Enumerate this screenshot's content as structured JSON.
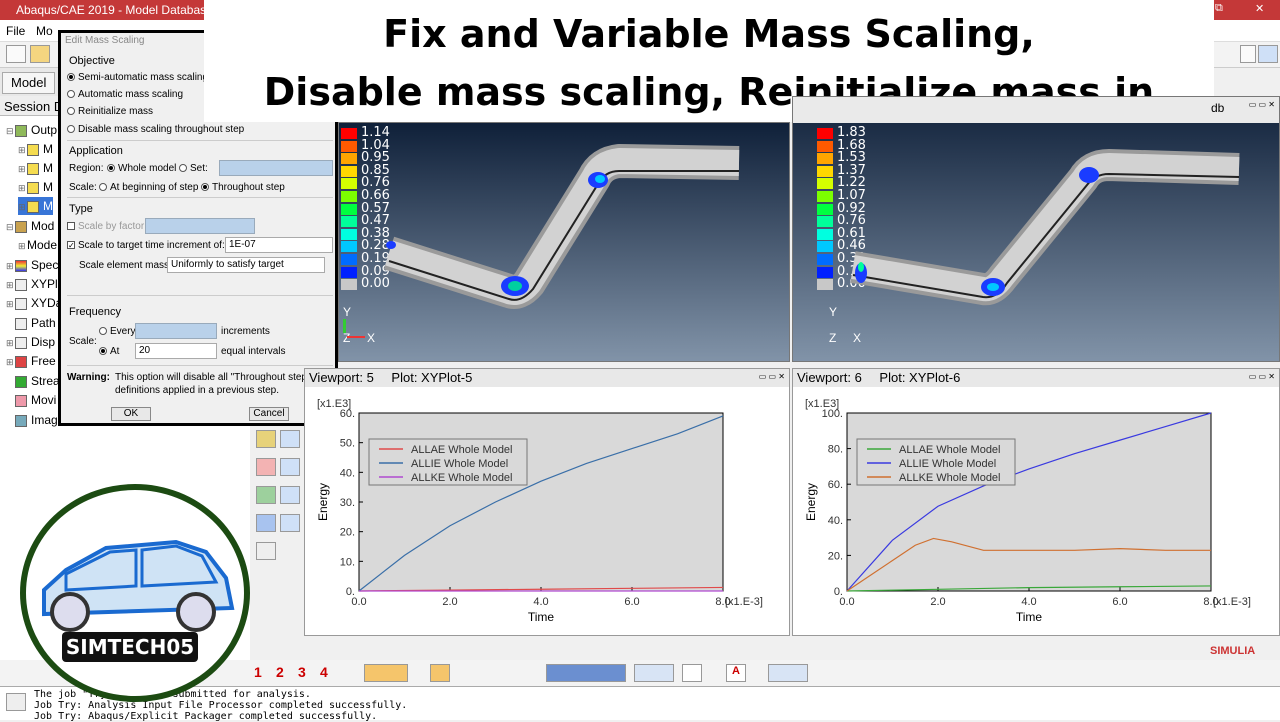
{
  "window": {
    "title": "Abaqus/CAE 2019 - Model Databas",
    "btn_restore": "⧉",
    "btn_close": "✕"
  },
  "menu": {
    "file": "File",
    "model": "Mo"
  },
  "tabs": {
    "model": "Model",
    "session": "Session D"
  },
  "tree": [
    {
      "label": "Outp",
      "icon": "output-db-icon"
    },
    {
      "label": "M",
      "icon": "lock-icon"
    },
    {
      "label": "M",
      "icon": "lock-icon"
    },
    {
      "label": "M",
      "icon": "lock-icon"
    },
    {
      "label": "M",
      "icon": "lock-icon"
    },
    {
      "label": "Mod",
      "icon": "model-icon"
    },
    {
      "label": "Mode",
      "icon": "model-icon"
    },
    {
      "label": "Spec",
      "icon": "spectrum-icon"
    },
    {
      "label": "XYPl",
      "icon": "xyplot-icon"
    },
    {
      "label": "XYDa",
      "icon": "xydata-icon"
    },
    {
      "label": "Path",
      "icon": "path-icon"
    },
    {
      "label": "Disp",
      "icon": "display-icon"
    },
    {
      "label": "Free",
      "icon": "freebody-icon"
    },
    {
      "label": "Strea",
      "icon": "stream-icon"
    },
    {
      "label": "Movi",
      "icon": "movie-icon"
    },
    {
      "label": "Imag",
      "icon": "image-icon"
    }
  ],
  "dialog": {
    "title": "Edit Mass Scaling",
    "objective": "Objective",
    "opt_semi": "Semi-automatic mass scaling",
    "opt_auto": "Automatic mass scaling",
    "opt_reinit": "Reinitialize mass",
    "opt_disable": "Disable mass scaling throughout step",
    "application": "Application",
    "region": "Region:",
    "whole_model": "Whole model",
    "set": "Set:",
    "scale": "Scale:",
    "at_beginning": "At beginning of step",
    "throughout": "Throughout step",
    "type": "Type",
    "scale_by_factor": "Scale by factor:",
    "scale_to_target": "Scale to target time increment of:",
    "target_value": "1E-07",
    "scale_elem_mass": "Scale element mass:",
    "elem_mass_value": "Uniformly to satisfy target",
    "frequency": "Frequency",
    "every": "Every",
    "increments": "increments",
    "at": "At",
    "at_value": "20",
    "equal_intervals": "equal intervals",
    "warning_label": "Warning:",
    "warning_text1": "This option will disable all \"Throughout step\"",
    "warning_text2": "definitions applied in a previous step.",
    "ok": "OK",
    "cancel": "Cancel"
  },
  "banner": {
    "line1": "Fix and Variable Mass Scaling,",
    "line2": "Disable mass scaling, Reinitialize mass in steps"
  },
  "contour_left": {
    "values": [
      "1.14",
      "1.04",
      "0.95",
      "0.85",
      "0.76",
      "0.66",
      "0.57",
      "0.47",
      "0.38",
      "0.28",
      "0.19",
      "0.09",
      "0.00"
    ]
  },
  "contour_right": {
    "values": [
      "1.83",
      "1.68",
      "1.53",
      "1.37",
      "1.22",
      "1.07",
      "0.92",
      "0.76",
      "0.61",
      "0.46",
      "0.31",
      "0.15",
      "0.00"
    ],
    "odb_label": "db"
  },
  "contour_colors": [
    "#ff0000",
    "#ff5a00",
    "#ffa500",
    "#ffd700",
    "#d4ff00",
    "#7cff00",
    "#00ff40",
    "#00ff9a",
    "#00ffe0",
    "#00c8ff",
    "#006cff",
    "#0020ff",
    "#c8c8c8"
  ],
  "triad": {
    "y": "Y",
    "z": "Z",
    "x": "X"
  },
  "viewport5": {
    "label": "Viewport: 5",
    "plot": "Plot: XYPlot-5"
  },
  "viewport6": {
    "label": "Viewport: 6",
    "plot": "Plot: XYPlot-6"
  },
  "chart_data": [
    {
      "type": "line",
      "ylabel": "Energy",
      "xlabel": "Time",
      "xunit": "[x1.E-3]",
      "yunit": "[x1.E3]",
      "xlim": [
        0,
        8
      ],
      "ylim": [
        0,
        60
      ],
      "xticks": [
        "0.0",
        "2.0",
        "4.0",
        "6.0",
        "8.0"
      ],
      "yticks": [
        "0.",
        "10.",
        "20.",
        "30.",
        "40.",
        "50.",
        "60."
      ],
      "series": [
        {
          "name": "ALLAE Whole Model",
          "color": "#e04a4a",
          "x": [
            0,
            2,
            4,
            6,
            8
          ],
          "y": [
            0,
            0.3,
            0.6,
            0.9,
            1.2
          ]
        },
        {
          "name": "ALLIE Whole Model",
          "color": "#3a6fa8",
          "x": [
            0,
            1,
            2,
            3,
            4,
            5,
            6,
            7,
            8
          ],
          "y": [
            0,
            12,
            22,
            30,
            37,
            43,
            48,
            53,
            59
          ]
        },
        {
          "name": "ALLKE Whole Model",
          "color": "#b04ad0",
          "x": [
            0,
            8
          ],
          "y": [
            0,
            0
          ]
        }
      ]
    },
    {
      "type": "line",
      "ylabel": "Energy",
      "xlabel": "Time",
      "xunit": "[x1.E-3]",
      "yunit": "[x1.E3]",
      "xlim": [
        0,
        8
      ],
      "ylim": [
        0,
        105
      ],
      "xticks": [
        "0.0",
        "2.0",
        "4.0",
        "6.0",
        "8.0"
      ],
      "yticks": [
        "0.",
        "20.",
        "40.",
        "60.",
        "80.",
        "100."
      ],
      "series": [
        {
          "name": "ALLAE Whole Model",
          "color": "#3aa83a",
          "x": [
            0,
            2,
            4,
            6,
            8
          ],
          "y": [
            0,
            1,
            2,
            2.5,
            3
          ]
        },
        {
          "name": "ALLIE Whole Model",
          "color": "#3a3ae0",
          "x": [
            0,
            1,
            2,
            3,
            4,
            5,
            6,
            7,
            8
          ],
          "y": [
            0,
            30,
            50,
            62,
            72,
            81,
            89,
            97,
            105
          ]
        },
        {
          "name": "ALLKE Whole Model",
          "color": "#d07030",
          "x": [
            0,
            0.5,
            1,
            1.5,
            1.9,
            2.3,
            3,
            4,
            5,
            6,
            7,
            8
          ],
          "y": [
            0,
            9,
            18,
            27,
            31,
            29,
            24,
            24,
            24,
            25,
            24,
            24
          ]
        }
      ]
    }
  ],
  "messages": {
    "line1": "The job \"Try\" has been submitted for analysis.",
    "line2": "Job Try: Analysis Input File Processor completed successfully.",
    "line3": "Job Try: Abaqus/Explicit Packager completed successfully."
  },
  "numbers_toolbar": [
    "1",
    "2",
    "3",
    "4"
  ],
  "brand": {
    "simulia": "SIMULIA",
    "logo_text": "SIMTECH05"
  }
}
